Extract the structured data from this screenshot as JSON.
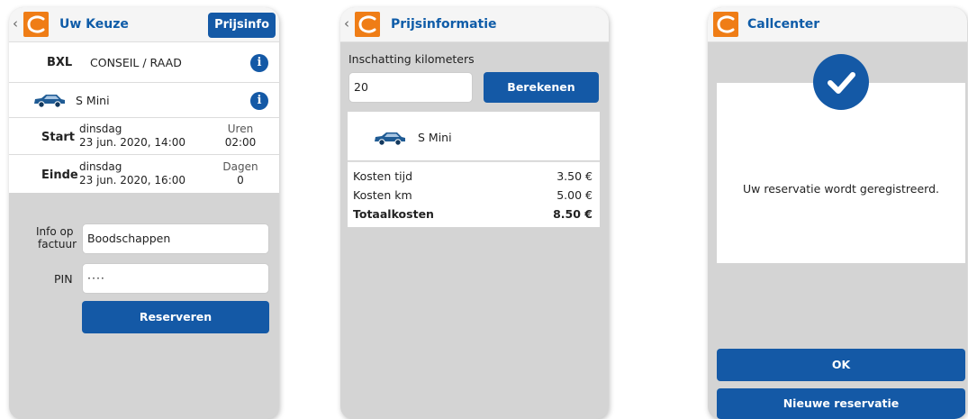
{
  "screen1": {
    "title": "Uw Keuze",
    "price_button": "Prijsinfo",
    "station_code": "BXL",
    "station_name": "CONSEIL / RAAD",
    "car_model": "S Mini",
    "start": {
      "label": "Start",
      "day": "dinsdag",
      "datetime": "23 jun. 2020, 14:00",
      "side_label": "Uren",
      "side_value": "02:00"
    },
    "end": {
      "label": "Einde",
      "day": "dinsdag",
      "datetime": "23 jun. 2020, 16:00",
      "side_label": "Dagen",
      "side_value": "0"
    },
    "invoice_label_1": "Info op",
    "invoice_label_2": "factuur",
    "invoice_value": "Boodschappen",
    "pin_label": "PIN",
    "pin_value": "····",
    "reserve_button": "Reserveren"
  },
  "screen2": {
    "title": "Prijsinformatie",
    "km_label": "Inschatting kilometers",
    "km_value": "20",
    "calc_button": "Berekenen",
    "car_model": "S Mini",
    "costs": [
      {
        "label": "Kosten tijd",
        "value": "3.50 €"
      },
      {
        "label": "Kosten km",
        "value": "5.00 €"
      }
    ],
    "total_label": "Totaalkosten",
    "total_value": "8.50 €"
  },
  "screen3": {
    "title": "Callcenter",
    "message": "Uw reservatie wordt geregistreerd.",
    "ok_button": "OK",
    "new_button": "Nieuwe reservatie"
  },
  "colors": {
    "brand_orange": "#ef7d16",
    "primary_blue": "#1459a6",
    "title_blue": "#0f5ca8"
  }
}
